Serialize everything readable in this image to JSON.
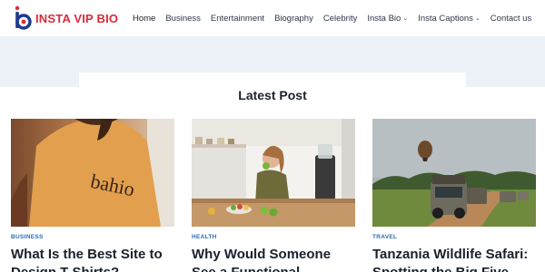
{
  "brand": {
    "name": "INSTA VIP BIO"
  },
  "nav": {
    "items": [
      {
        "label": "Home"
      },
      {
        "label": "Business"
      },
      {
        "label": "Entertainment"
      },
      {
        "label": "Biography"
      },
      {
        "label": "Celebrity"
      },
      {
        "label": "Insta Bio"
      },
      {
        "label": "Insta Captions"
      },
      {
        "label": "Contact us"
      }
    ]
  },
  "section": {
    "title": "Latest Post"
  },
  "cards": [
    {
      "category": "BUSINESS",
      "title": "What Is the Best Site to Design T-Shirts?",
      "shirt_text": "bahio"
    },
    {
      "category": "HEALTH",
      "title": "Why Would Someone See a Functional"
    },
    {
      "category": "TRAVEL",
      "title": "Tanzania Wildlife Safari: Spotting the Big Five"
    }
  ],
  "colors": {
    "brand": "#d92b3a",
    "category": "#2b6cb0",
    "accent_blue": "#1e3a8a"
  }
}
